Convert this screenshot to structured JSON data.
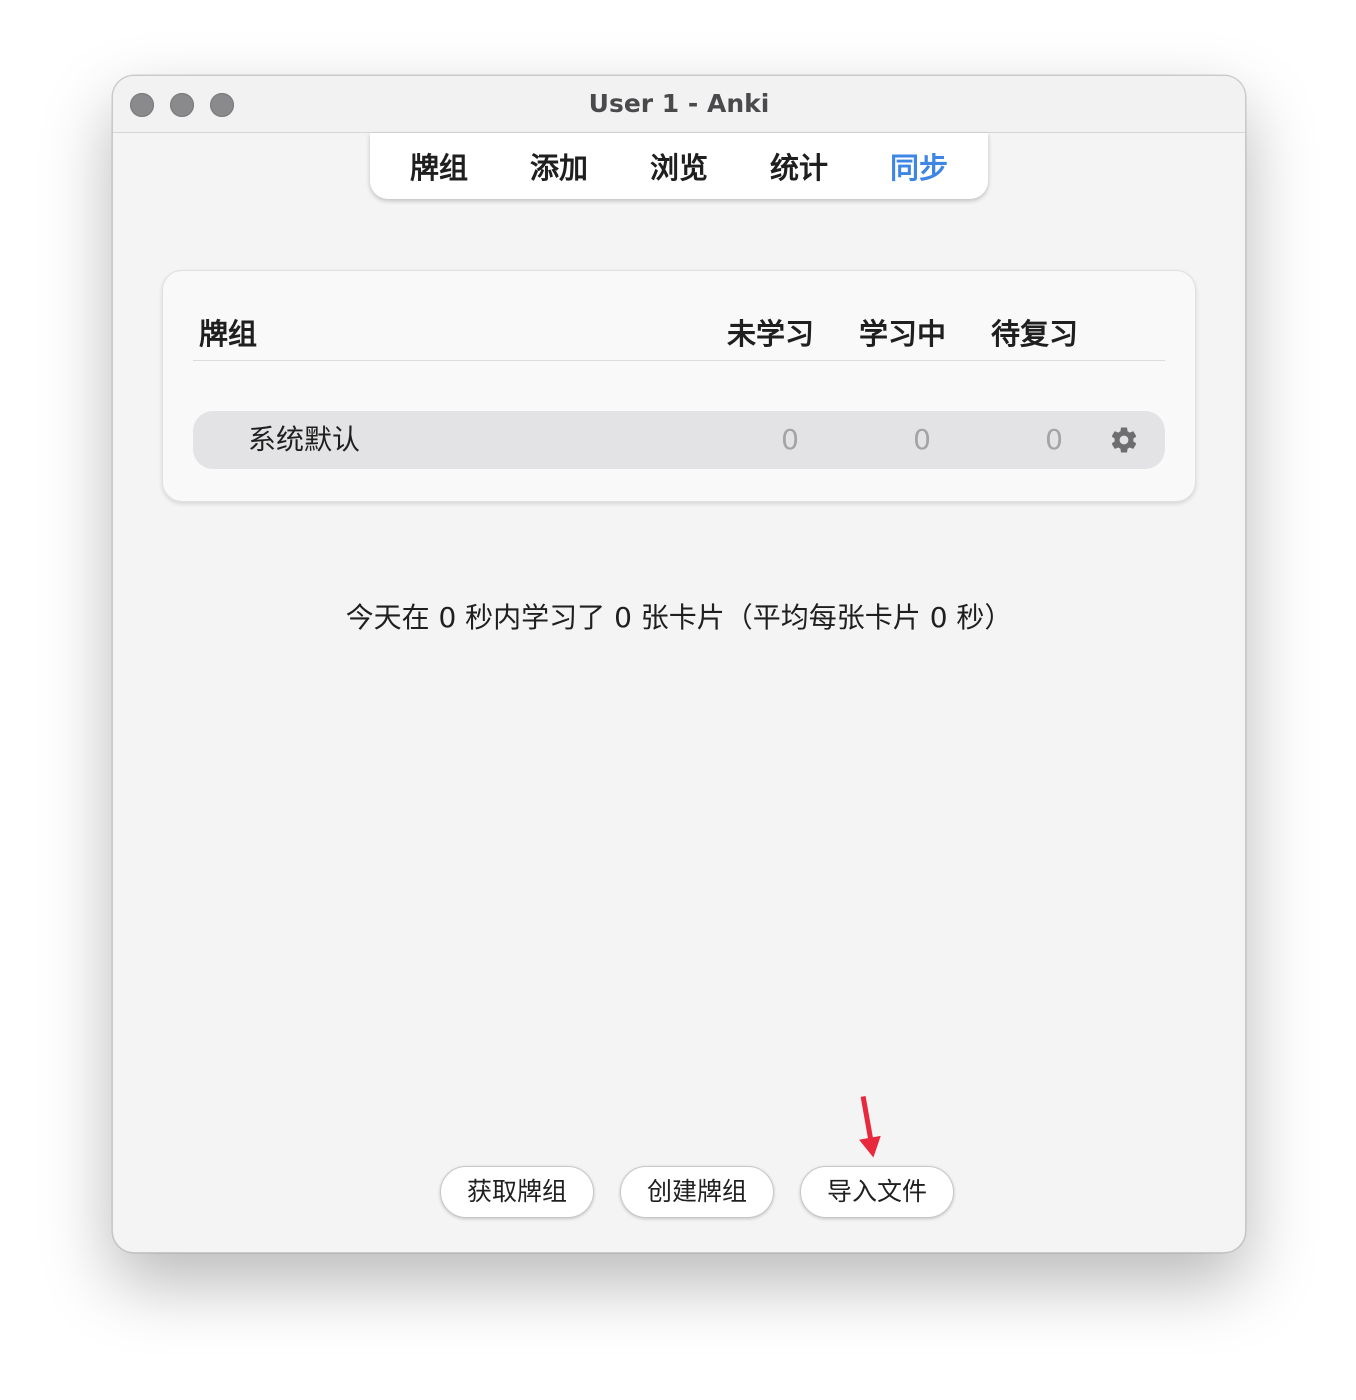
{
  "window": {
    "title": "User 1 - Anki"
  },
  "toolbar": {
    "tabs": [
      {
        "label": "牌组"
      },
      {
        "label": "添加"
      },
      {
        "label": "浏览"
      },
      {
        "label": "统计"
      },
      {
        "label": "同步",
        "active": true
      }
    ]
  },
  "deck_table": {
    "headers": {
      "deck": "牌组",
      "new": "未学习",
      "learning": "学习中",
      "due": "待复习"
    },
    "rows": [
      {
        "name": "系统默认",
        "new": "0",
        "learning": "0",
        "due": "0",
        "options_icon": "gear-icon"
      }
    ]
  },
  "stats": {
    "text": "今天在 0 秒内学习了 0 张卡片（平均每张卡片 0 秒）"
  },
  "buttons": {
    "get_shared": "获取牌组",
    "create_deck": "创建牌组",
    "import_file": "导入文件"
  },
  "colors": {
    "accent": "#3e86e3",
    "annotation_arrow": "#e8283c"
  }
}
